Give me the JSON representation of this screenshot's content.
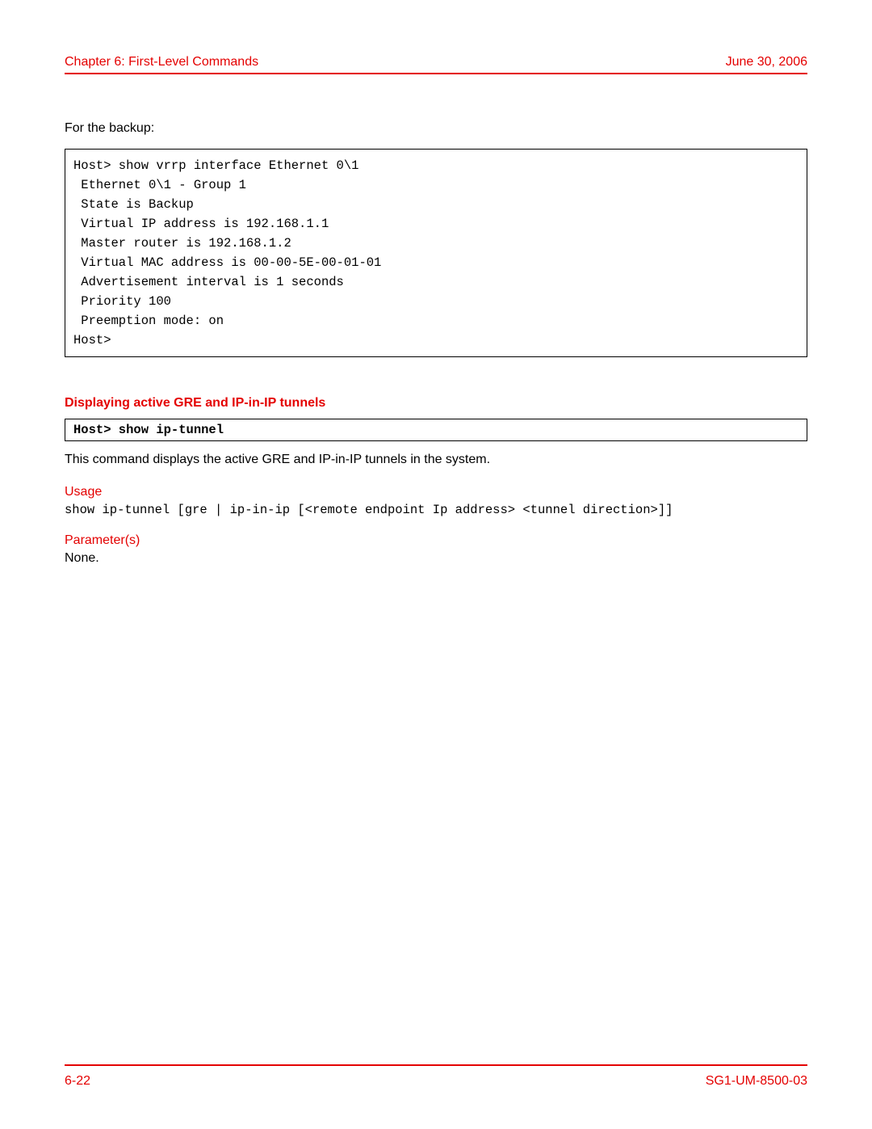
{
  "header": {
    "left": "Chapter 6: First-Level Commands",
    "right": "June 30, 2006"
  },
  "intro_text": "For the backup:",
  "code_block": "Host> show vrrp interface Ethernet 0\\1\n Ethernet 0\\1 - Group 1\n State is Backup\n Virtual IP address is 192.168.1.1\n Master router is 192.168.1.2\n Virtual MAC address is 00-00-5E-00-01-01\n Advertisement interval is 1 seconds\n Priority 100\n Preemption mode: on\nHost>",
  "section": {
    "heading": "Displaying active GRE and IP-in-IP tunnels",
    "command": "Host> show ip-tunnel",
    "description": "This command displays the active GRE and IP-in-IP tunnels in the system.",
    "usage_label": "Usage",
    "usage_code": "show ip-tunnel [gre | ip-in-ip [<remote endpoint Ip address> <tunnel direction>]]",
    "params_label": "Parameter(s)",
    "params_text": "None."
  },
  "footer": {
    "left": "6-22",
    "right": "SG1-UM-8500-03"
  }
}
